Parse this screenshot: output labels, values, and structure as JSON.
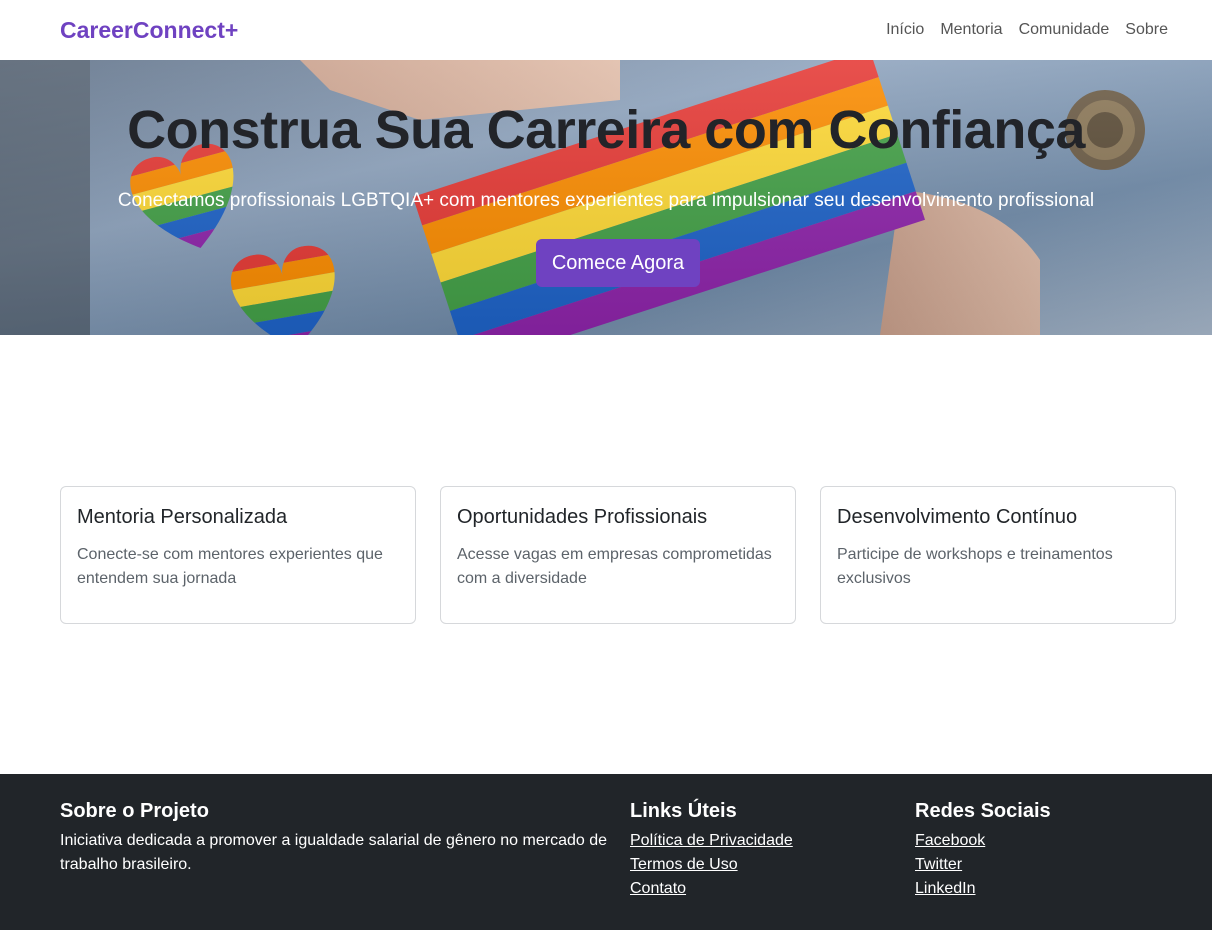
{
  "navbar": {
    "brand": "CareerConnect+",
    "links": [
      "Início",
      "Mentoria",
      "Comunidade",
      "Sobre"
    ]
  },
  "hero": {
    "title": "Construa Sua Carreira com Confiança",
    "subtitle": "Conectamos profissionais LGBTQIA+ com mentores experientes para impulsionar seu desenvolvimento profissional",
    "cta_label": "Comece Agora"
  },
  "features": [
    {
      "title": "Mentoria Personalizada",
      "text": "Conecte-se com mentores experientes que entendem sua jornada"
    },
    {
      "title": "Oportunidades Profissionais",
      "text": "Acesse vagas em empresas comprometidas com a diversidade"
    },
    {
      "title": "Desenvolvimento Contínuo",
      "text": "Participe de workshops e treinamentos exclusivos"
    }
  ],
  "footer": {
    "about": {
      "title": "Sobre o Projeto",
      "text": "Iniciativa dedicada a promover a igualdade salarial de gênero no mercado de trabalho brasileiro."
    },
    "links": {
      "title": "Links Úteis",
      "items": [
        "Política de Privacidade",
        "Termos de Uso",
        "Contato"
      ]
    },
    "social": {
      "title": "Redes Sociais",
      "items": [
        "Facebook",
        "Twitter",
        "LinkedIn"
      ]
    }
  },
  "colors": {
    "brand": "#6f42c1",
    "footer_bg": "#212529",
    "text": "#212529"
  }
}
